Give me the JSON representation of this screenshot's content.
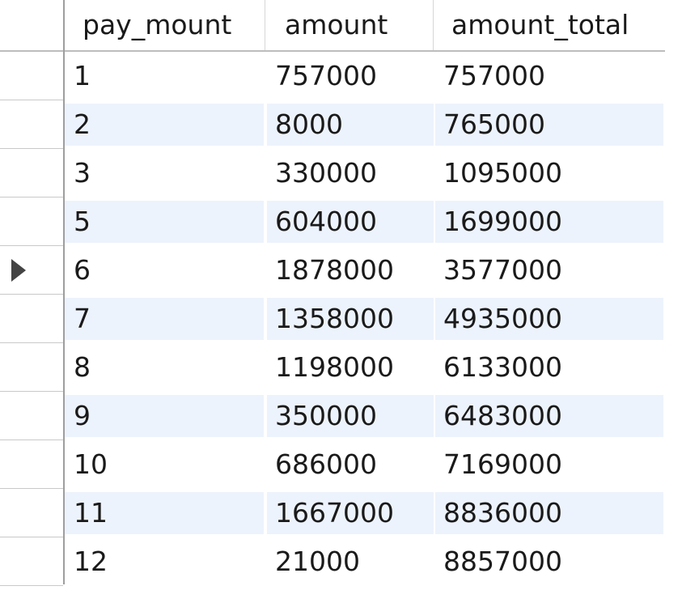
{
  "grid": {
    "columns": [
      "pay_mount",
      "amount",
      "amount_total"
    ],
    "current_row_index": 4,
    "rows": [
      [
        "1",
        "757000",
        "757000"
      ],
      [
        "2",
        "8000",
        "765000"
      ],
      [
        "3",
        "330000",
        "1095000"
      ],
      [
        "5",
        "604000",
        "1699000"
      ],
      [
        "6",
        "1878000",
        "3577000"
      ],
      [
        "7",
        "1358000",
        "4935000"
      ],
      [
        "8",
        "1198000",
        "6133000"
      ],
      [
        "9",
        "350000",
        "6483000"
      ],
      [
        "10",
        "686000",
        "7169000"
      ],
      [
        "11",
        "1667000",
        "8836000"
      ],
      [
        "12",
        "21000",
        "8857000"
      ]
    ]
  },
  "icons": {
    "current_row_marker": "current-row-pointer-icon"
  }
}
